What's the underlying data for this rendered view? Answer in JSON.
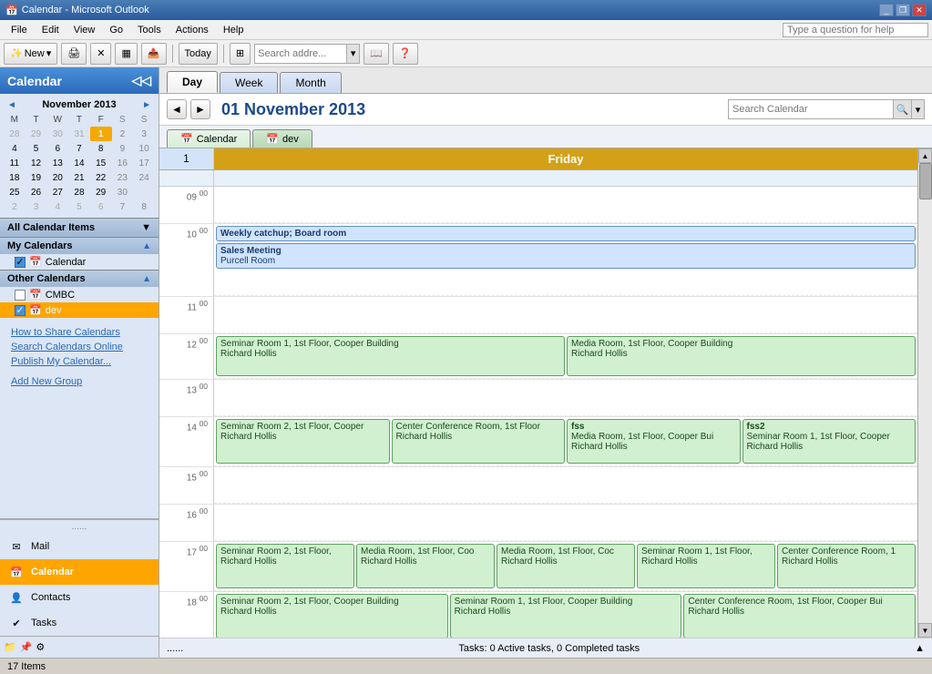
{
  "titleBar": {
    "title": "Calendar - Microsoft Outlook",
    "icon": "📅"
  },
  "menuBar": {
    "items": [
      "File",
      "Edit",
      "View",
      "Go",
      "Tools",
      "Actions",
      "Help"
    ],
    "helpPlaceholder": "Type a question for help"
  },
  "toolbar": {
    "newLabel": "New",
    "todayLabel": "Today",
    "searchAddrPlaceholder": "Search addre..."
  },
  "sidebar": {
    "header": "Calendar",
    "miniCal": {
      "month": "November 2013",
      "weekdays": [
        "M",
        "T",
        "W",
        "T",
        "F",
        "S",
        "S"
      ],
      "weeks": [
        [
          "28",
          "29",
          "30",
          "31",
          "1",
          "2",
          "3"
        ],
        [
          "4",
          "5",
          "6",
          "7",
          "8",
          "9",
          "10"
        ],
        [
          "11",
          "12",
          "13",
          "14",
          "15",
          "16",
          "17"
        ],
        [
          "18",
          "19",
          "20",
          "21",
          "22",
          "23",
          "24"
        ],
        [
          "25",
          "26",
          "27",
          "28",
          "29",
          "30",
          ""
        ],
        [
          "2",
          "3",
          "4",
          "5",
          "6",
          "7",
          "8"
        ]
      ],
      "today": "1",
      "todayWeek": 0,
      "todayDay": 4
    },
    "allCalLabel": "All Calendar Items",
    "myCalendars": {
      "label": "My Calendars",
      "items": [
        {
          "name": "Calendar",
          "checked": true
        }
      ]
    },
    "otherCalendars": {
      "label": "Other Calendars",
      "items": [
        {
          "name": "CMBC",
          "checked": false
        },
        {
          "name": "dev",
          "checked": true
        }
      ]
    },
    "links": [
      "How to Share Calendars",
      "Search Calendars Online",
      "Publish My Calendar...",
      "Add New Group"
    ],
    "navButtons": [
      {
        "label": "Mail",
        "icon": "✉"
      },
      {
        "label": "Calendar",
        "icon": "📅",
        "active": true
      },
      {
        "label": "Contacts",
        "icon": "👤"
      },
      {
        "label": "Tasks",
        "icon": "✔"
      }
    ]
  },
  "mainView": {
    "viewTabs": [
      "Day",
      "Week",
      "Month"
    ],
    "activeViewTab": "Day",
    "dateTitle": "01 November 2013",
    "searchPlaceholder": "Search Calendar",
    "calTabs": [
      "Calendar",
      "dev"
    ],
    "dayHeader": "Friday",
    "dayNum": "1",
    "events": {
      "time1000": {
        "label": "Weekly catchup; Board room",
        "type": "blue"
      },
      "time1000b": {
        "label": "Sales Meeting",
        "sublabel": "Purcell Room",
        "type": "blue"
      },
      "time1200a": {
        "label": "Seminar Room 1, 1st Floor, Cooper Building",
        "sublabel": "Richard Hollis",
        "type": "green"
      },
      "time1200b": {
        "label": "Media Room, 1st Floor, Cooper Building",
        "sublabel": "Richard Hollis",
        "type": "green"
      },
      "time1400a": {
        "label": "Seminar Room 2, 1st Floor, Cooper",
        "sublabel": "Richard Hollis",
        "type": "green"
      },
      "time1400b": {
        "label": "Center Conference Room, 1st Floor",
        "sublabel": "Richard Hollis",
        "type": "green"
      },
      "time1400c": {
        "label": "fss",
        "sublabel": "Media Room, 1st Floor, Cooper Bui",
        "sublabel2": "Richard Hollis",
        "type": "green"
      },
      "time1400d": {
        "label": "fss2",
        "sublabel": "Seminar Room 1, 1st Floor, Cooper",
        "sublabel2": "Richard Hollis",
        "type": "green"
      },
      "time1700a": {
        "label": "Seminar Room 2, 1st Floor,",
        "sublabel": "Richard Hollis",
        "type": "green"
      },
      "time1700b": {
        "label": "Media Room, 1st Floor, Coo",
        "sublabel": "Richard Hollis",
        "type": "green"
      },
      "time1700c": {
        "label": "Media Room, 1st Floor, Coc",
        "sublabel": "Richard Hollis",
        "type": "green"
      },
      "time1700d": {
        "label": "Seminar Room 1, 1st Floor,",
        "sublabel": "Richard Hollis",
        "type": "green"
      },
      "time1700e": {
        "label": "Center Conference Room, 1",
        "sublabel": "Richard Hollis",
        "type": "green"
      },
      "time1800a": {
        "label": "Seminar Room 2, 1st Floor, Cooper Building",
        "sublabel": "Richard Hollis",
        "type": "green"
      },
      "time1800b": {
        "label": "Seminar Room 1, 1st Floor, Cooper Building",
        "sublabel": "Richard Hollis",
        "type": "green"
      },
      "time1800c": {
        "label": "Center Conference Room, 1st Floor, Cooper Bui",
        "sublabel": "Richard Hollis",
        "type": "green"
      }
    },
    "tasksFooter": "Tasks: 0 Active tasks, 0 Completed tasks"
  },
  "statusBar": {
    "label": "17 Items"
  }
}
